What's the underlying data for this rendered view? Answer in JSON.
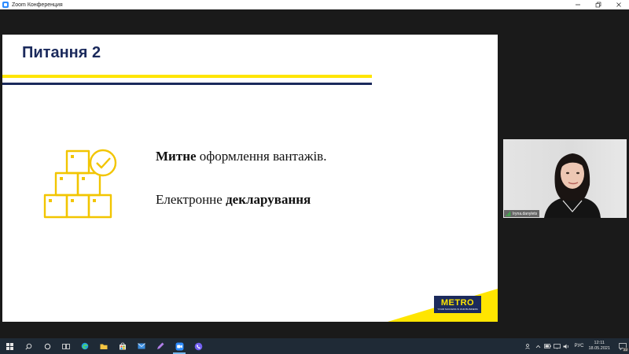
{
  "window": {
    "title": "Zoom Конференция",
    "icon": "zoom-app-icon",
    "controls": [
      "minimize-icon",
      "restore-icon",
      "close-icon"
    ]
  },
  "slide": {
    "title": "Питання 2",
    "line1": {
      "bold": "Митне",
      "rest": " оформлення вантажів."
    },
    "line2": {
      "normal": "Електронне ",
      "bold": "декларування"
    },
    "logo": {
      "word": "METRO",
      "tagline": "YOUR SUCCESS IS OUR BUSINESS"
    },
    "colors": {
      "navy": "#1b2a5c",
      "yellow": "#ffe500"
    }
  },
  "video": {
    "participant_name": "Iryna.danylets"
  },
  "taskbar": {
    "apps": [
      "windows-start-icon",
      "search-icon",
      "cortana-icon",
      "task-view-icon",
      "edge-icon",
      "store-icon",
      "store-bag-icon",
      "mail-icon",
      "pen-icon",
      "zoom-icon",
      "viber-icon"
    ],
    "language": "РУС",
    "time": "12:11",
    "date": "18.05.2021",
    "notifications": "22"
  }
}
